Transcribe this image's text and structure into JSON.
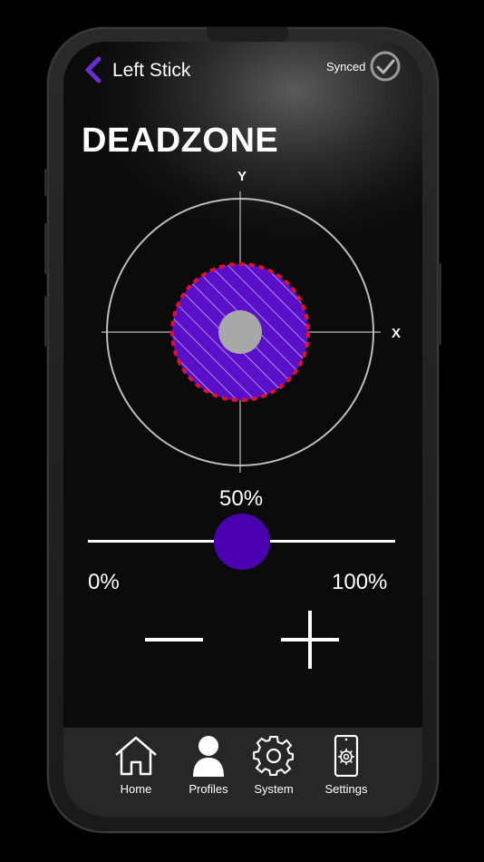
{
  "header": {
    "title": "Left Stick",
    "sync_status": "Synced"
  },
  "page": {
    "heading": "DEADZONE"
  },
  "joystick": {
    "axis_y_label": "Y",
    "axis_x_label": "X",
    "deadzone_fraction": 0.5
  },
  "slider": {
    "value_label": "50%",
    "value_fraction": 0.5,
    "min_label": "0%",
    "max_label": "100%"
  },
  "nav": {
    "items": [
      {
        "label": "Home",
        "icon": "home-icon"
      },
      {
        "label": "Profiles",
        "icon": "person-icon"
      },
      {
        "label": "System",
        "icon": "gear-icon"
      },
      {
        "label": "Settings",
        "icon": "phone-gear-icon"
      }
    ]
  },
  "colors": {
    "accent": "#4a00b0",
    "deadzone_fill": "#5a10c8",
    "deadzone_border": "#e0102e",
    "back_arrow": "#6a2fd0"
  }
}
